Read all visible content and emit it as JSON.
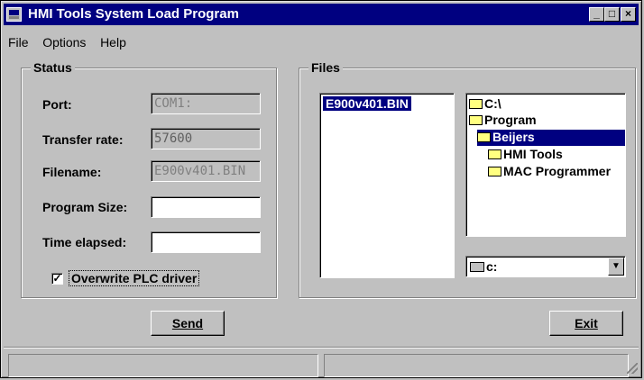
{
  "window": {
    "title": "HMI Tools System Load Program",
    "minimize": "_",
    "maximize": "□",
    "close": "×"
  },
  "menu": [
    "File",
    "Options",
    "Help"
  ],
  "status_group": {
    "label": "Status",
    "port_label": "Port:",
    "port_value": "COM1:",
    "rate_label": "Transfer rate:",
    "rate_value": "57600",
    "filename_label": "Filename:",
    "filename_value": "E900v401.BIN",
    "size_label": "Program Size:",
    "size_value": "",
    "time_label": "Time elapsed:",
    "time_value": "",
    "overwrite_label": "Overwrite PLC driver",
    "overwrite_checked": "✓"
  },
  "files_group": {
    "label": "Files",
    "files": [
      "E900v401.BIN"
    ],
    "dirs": [
      "C:\\",
      "Program",
      "Beijers",
      "HMI Tools",
      "MAC Programmer"
    ],
    "drive": "c:",
    "drive_arrow": "▼"
  },
  "buttons": {
    "send": "Send",
    "exit": "Exit"
  }
}
